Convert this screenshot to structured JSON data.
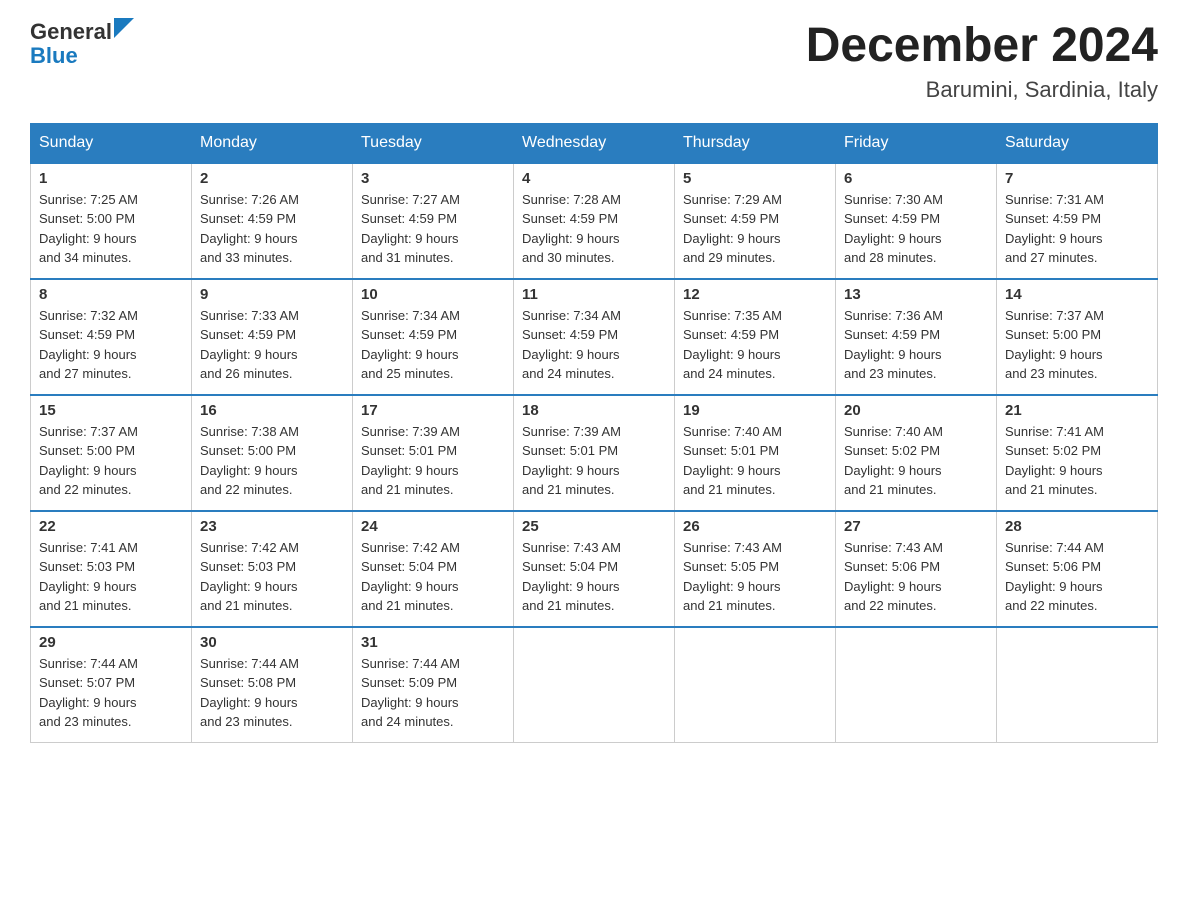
{
  "header": {
    "logo_general": "General",
    "logo_blue": "Blue",
    "month_title": "December 2024",
    "location": "Barumini, Sardinia, Italy"
  },
  "days_of_week": [
    "Sunday",
    "Monday",
    "Tuesday",
    "Wednesday",
    "Thursday",
    "Friday",
    "Saturday"
  ],
  "weeks": [
    [
      {
        "day": "1",
        "sunrise": "7:25 AM",
        "sunset": "5:00 PM",
        "daylight": "9 hours and 34 minutes."
      },
      {
        "day": "2",
        "sunrise": "7:26 AM",
        "sunset": "4:59 PM",
        "daylight": "9 hours and 33 minutes."
      },
      {
        "day": "3",
        "sunrise": "7:27 AM",
        "sunset": "4:59 PM",
        "daylight": "9 hours and 31 minutes."
      },
      {
        "day": "4",
        "sunrise": "7:28 AM",
        "sunset": "4:59 PM",
        "daylight": "9 hours and 30 minutes."
      },
      {
        "day": "5",
        "sunrise": "7:29 AM",
        "sunset": "4:59 PM",
        "daylight": "9 hours and 29 minutes."
      },
      {
        "day": "6",
        "sunrise": "7:30 AM",
        "sunset": "4:59 PM",
        "daylight": "9 hours and 28 minutes."
      },
      {
        "day": "7",
        "sunrise": "7:31 AM",
        "sunset": "4:59 PM",
        "daylight": "9 hours and 27 minutes."
      }
    ],
    [
      {
        "day": "8",
        "sunrise": "7:32 AM",
        "sunset": "4:59 PM",
        "daylight": "9 hours and 27 minutes."
      },
      {
        "day": "9",
        "sunrise": "7:33 AM",
        "sunset": "4:59 PM",
        "daylight": "9 hours and 26 minutes."
      },
      {
        "day": "10",
        "sunrise": "7:34 AM",
        "sunset": "4:59 PM",
        "daylight": "9 hours and 25 minutes."
      },
      {
        "day": "11",
        "sunrise": "7:34 AM",
        "sunset": "4:59 PM",
        "daylight": "9 hours and 24 minutes."
      },
      {
        "day": "12",
        "sunrise": "7:35 AM",
        "sunset": "4:59 PM",
        "daylight": "9 hours and 24 minutes."
      },
      {
        "day": "13",
        "sunrise": "7:36 AM",
        "sunset": "4:59 PM",
        "daylight": "9 hours and 23 minutes."
      },
      {
        "day": "14",
        "sunrise": "7:37 AM",
        "sunset": "5:00 PM",
        "daylight": "9 hours and 23 minutes."
      }
    ],
    [
      {
        "day": "15",
        "sunrise": "7:37 AM",
        "sunset": "5:00 PM",
        "daylight": "9 hours and 22 minutes."
      },
      {
        "day": "16",
        "sunrise": "7:38 AM",
        "sunset": "5:00 PM",
        "daylight": "9 hours and 22 minutes."
      },
      {
        "day": "17",
        "sunrise": "7:39 AM",
        "sunset": "5:01 PM",
        "daylight": "9 hours and 21 minutes."
      },
      {
        "day": "18",
        "sunrise": "7:39 AM",
        "sunset": "5:01 PM",
        "daylight": "9 hours and 21 minutes."
      },
      {
        "day": "19",
        "sunrise": "7:40 AM",
        "sunset": "5:01 PM",
        "daylight": "9 hours and 21 minutes."
      },
      {
        "day": "20",
        "sunrise": "7:40 AM",
        "sunset": "5:02 PM",
        "daylight": "9 hours and 21 minutes."
      },
      {
        "day": "21",
        "sunrise": "7:41 AM",
        "sunset": "5:02 PM",
        "daylight": "9 hours and 21 minutes."
      }
    ],
    [
      {
        "day": "22",
        "sunrise": "7:41 AM",
        "sunset": "5:03 PM",
        "daylight": "9 hours and 21 minutes."
      },
      {
        "day": "23",
        "sunrise": "7:42 AM",
        "sunset": "5:03 PM",
        "daylight": "9 hours and 21 minutes."
      },
      {
        "day": "24",
        "sunrise": "7:42 AM",
        "sunset": "5:04 PM",
        "daylight": "9 hours and 21 minutes."
      },
      {
        "day": "25",
        "sunrise": "7:43 AM",
        "sunset": "5:04 PM",
        "daylight": "9 hours and 21 minutes."
      },
      {
        "day": "26",
        "sunrise": "7:43 AM",
        "sunset": "5:05 PM",
        "daylight": "9 hours and 21 minutes."
      },
      {
        "day": "27",
        "sunrise": "7:43 AM",
        "sunset": "5:06 PM",
        "daylight": "9 hours and 22 minutes."
      },
      {
        "day": "28",
        "sunrise": "7:44 AM",
        "sunset": "5:06 PM",
        "daylight": "9 hours and 22 minutes."
      }
    ],
    [
      {
        "day": "29",
        "sunrise": "7:44 AM",
        "sunset": "5:07 PM",
        "daylight": "9 hours and 23 minutes."
      },
      {
        "day": "30",
        "sunrise": "7:44 AM",
        "sunset": "5:08 PM",
        "daylight": "9 hours and 23 minutes."
      },
      {
        "day": "31",
        "sunrise": "7:44 AM",
        "sunset": "5:09 PM",
        "daylight": "9 hours and 24 minutes."
      },
      null,
      null,
      null,
      null
    ]
  ],
  "labels": {
    "sunrise": "Sunrise:",
    "sunset": "Sunset:",
    "daylight": "Daylight:"
  }
}
